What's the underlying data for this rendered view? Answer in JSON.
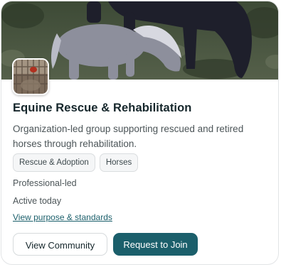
{
  "community": {
    "name": "Equine Rescue & Rehabilitation",
    "description": "Organization-led group supporting rescued and retired horses through rehabilitation.",
    "tags": [
      "Rescue & Adoption",
      "Horses"
    ],
    "leadership": "Professional-led",
    "activity": "Active today",
    "purpose_link": "View purpose & standards"
  },
  "actions": {
    "view_label": "View Community",
    "join_label": "Request to Join"
  },
  "images": {
    "cover": "horses-cover-image",
    "avatar": "community-avatar-image"
  },
  "colors": {
    "accent": "#1b5f6b",
    "title": "#15262b",
    "body_text": "#4c5558"
  }
}
